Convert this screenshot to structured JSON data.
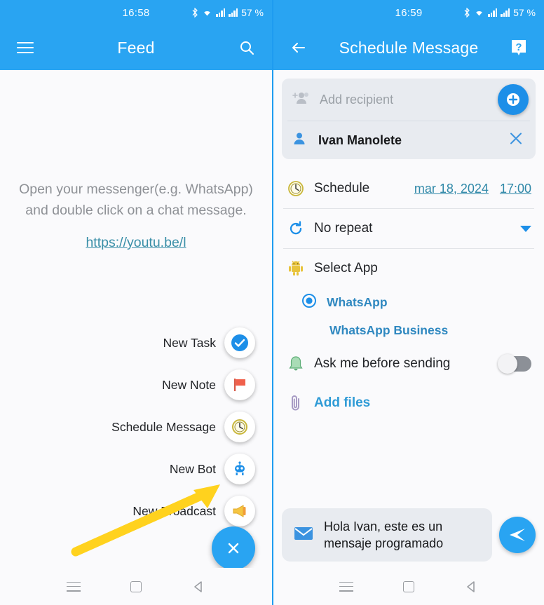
{
  "left": {
    "status": {
      "time": "16:58",
      "battery": "57 %"
    },
    "appbar": {
      "title": "Feed",
      "menu_icon": "hamburger-menu-icon",
      "search_icon": "search-icon"
    },
    "empty_state": {
      "line1": "Open your messenger(e.g. WhatsApp)",
      "line2": "and double click on a chat message.",
      "link": "https://youtu.be/l"
    },
    "fab_items": [
      {
        "label": "New Task",
        "icon": "check-circle-icon"
      },
      {
        "label": "New Note",
        "icon": "flag-icon"
      },
      {
        "label": "Schedule Message",
        "icon": "clock-icon"
      },
      {
        "label": "New Bot",
        "icon": "robot-icon"
      },
      {
        "label": "New Broadcast",
        "icon": "megaphone-icon"
      }
    ],
    "fab_main": {
      "label": "Close menu",
      "icon": "close-icon"
    }
  },
  "right": {
    "status": {
      "time": "16:59",
      "battery": "57 %"
    },
    "appbar": {
      "title": "Schedule Message",
      "back_icon": "arrow-left-icon",
      "help_icon": "help-question-icon"
    },
    "recipients": {
      "placeholder": "Add recipient",
      "add_icon": "add-recipient-icon",
      "add_button_icon": "plus-circle-icon",
      "selected": [
        {
          "name": "Ivan Manolete",
          "avatar_icon": "person-icon",
          "remove_icon": "close-x-icon"
        }
      ]
    },
    "schedule": {
      "label": "Schedule",
      "icon": "clock-icon",
      "date": "mar 18, 2024",
      "time": "17:00"
    },
    "repeat": {
      "label": "No repeat",
      "icon": "refresh-icon",
      "chevron": "chevron-down-icon"
    },
    "select_app": {
      "label": "Select App",
      "icon": "android-robot-icon",
      "options": [
        {
          "label": "WhatsApp",
          "selected": true
        },
        {
          "label": "WhatsApp Business",
          "selected": false
        }
      ]
    },
    "ask_before": {
      "label": "Ask me before sending",
      "icon": "bell-icon",
      "toggle_state": "off"
    },
    "add_files": {
      "label": "Add files",
      "icon": "paperclip-icon"
    },
    "composer": {
      "message": "Hola Ivan, este es un mensaje programado",
      "message_icon": "envelope-icon",
      "send_icon": "send-icon"
    }
  },
  "navbar": {
    "recents": "recents-button",
    "home": "home-button",
    "back": "back-button"
  }
}
